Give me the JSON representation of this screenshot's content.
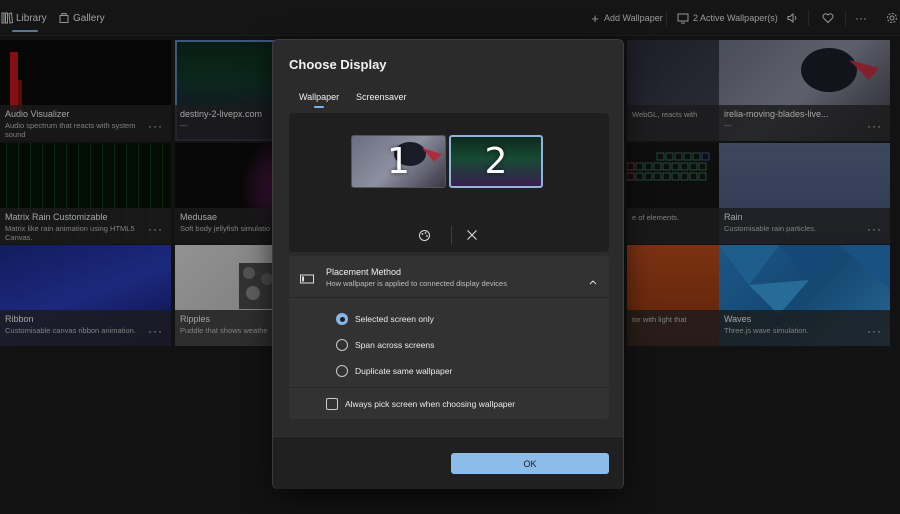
{
  "topbar": {
    "library_label": "Library",
    "gallery_label": "Gallery",
    "add_wallpaper_label": "Add Wallpaper",
    "active_wallpapers_label": "2 Active Wallpaper(s)",
    "more_label": "···"
  },
  "tiles": [
    {
      "title": "Audio Visualizer",
      "desc": "Audio spectrum that reacts with system sound"
    },
    {
      "title": "destiny-2-livepx.com",
      "desc": "---"
    },
    {
      "title": "",
      "desc": "WebGL, reacts with"
    },
    {
      "title": "irelia-moving-blades-live...",
      "desc": "---"
    },
    {
      "title": "Matrix Rain Customizable",
      "desc": "Matrix like rain animation using HTML5 Canvas."
    },
    {
      "title": "Medusae",
      "desc": "Soft body jellyfish simulatio"
    },
    {
      "title": "",
      "desc": "e of elements."
    },
    {
      "title": "Rain",
      "desc": "Customisable rain particles."
    },
    {
      "title": "Ribbon",
      "desc": "Customisable canvas ribbon animation."
    },
    {
      "title": "Ripples",
      "desc": "Puddle that shows weathe"
    },
    {
      "title": "",
      "desc": "tor with light that"
    },
    {
      "title": "Waves",
      "desc": "Three.js wave simulation."
    }
  ],
  "dialog": {
    "title": "Choose Display",
    "tabs": [
      "Wallpaper",
      "Screensaver"
    ],
    "monitors": [
      "1",
      "2"
    ],
    "placement_title": "Placement Method",
    "placement_subtitle": "How wallpaper is applied to connected display devices",
    "options": [
      "Selected screen only",
      "Span across screens",
      "Duplicate same wallpaper"
    ],
    "selected_option": "Selected screen only",
    "checkbox_label": "Always pick screen when choosing wallpaper",
    "ok_label": "OK"
  },
  "colors": {
    "accent": "#8cbcea",
    "dialog_bg": "#2b2b2b",
    "app_bg": "#1b1b1b"
  }
}
